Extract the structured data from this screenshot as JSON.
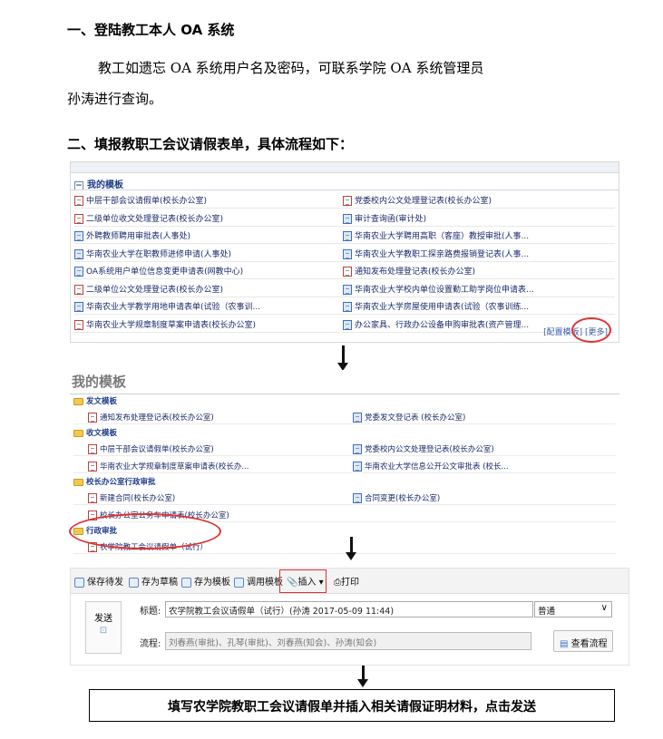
{
  "heading1": "一、登陆教工本人 OA 系统",
  "paragraph_line1": "教工如遗忘 OA 系统用户名及密码，可联系学院 OA 系统管理员",
  "paragraph_line2": "孙涛进行查询。",
  "heading2": "二、填报教职工会议请假表单，具体流程如下：",
  "panel1": {
    "title": "我的模板",
    "rows": [
      {
        "left": "中层干部会议请假单(校长办公室)",
        "right": "党委校内公文处理登记表(校长办公室)"
      },
      {
        "left": "二级单位收文处理登记表(校长办公室)",
        "right": "审计查询函(审计处)"
      },
      {
        "left": "外聘教师聘用审批表(人事处)",
        "right": "华南农业大学聘用高职（客座）教授审批(人事..."
      },
      {
        "left": "华南农业大学在职教师进修申请(人事处)",
        "right": "华南农业大学教职工探亲路费报销登记表(人事..."
      },
      {
        "left": "OA系统用户单位信息变更申请表(网教中心)",
        "right": "通知发布处理登记表(校长办公室)"
      },
      {
        "left": "二级单位公文处理登记表(校长办公室)",
        "right": "华南农业大学校内单位设置勤工助学岗位申请表..."
      },
      {
        "left": "华南农业大学教学用地申请表单(试验（农事训...",
        "right": "华南农业大学房屋使用申请表(试验（农事训练..."
      },
      {
        "left": "华南农业大学规章制度草案申请表(校长办公室)",
        "right": "办公家具、行政办公设备申购审批表(资产管理..."
      }
    ],
    "footer_config": "[配置模板]",
    "footer_more": "[更多]"
  },
  "panel2": {
    "title": "我的模板",
    "groups": [
      {
        "name": "发文模板",
        "rows": [
          {
            "left": "通知发布处理登记表(校长办公室)",
            "right": "党委发文登记表 (校长办公室)"
          }
        ]
      },
      {
        "name": "收文模板",
        "rows": [
          {
            "left": "中层干部会议请假单(校长办公室)",
            "right": "党委校内公文处理登记表(校长办公室)"
          },
          {
            "left": "华南农业大学规章制度草案申请表(校长办...",
            "right": "华南农业大学信息公开公文审批表 (校长..."
          }
        ]
      },
      {
        "name": "校长办公室行政审批",
        "rows": [
          {
            "left": "新建合同(校长办公室)",
            "right": "合同变更(校长办公室)"
          },
          {
            "left": "校长办公室公务车申请表(校长办公室)",
            "right": ""
          }
        ]
      },
      {
        "name": "行政审批",
        "rows": [
          {
            "left": "农学院教工会议请假单（试行）",
            "right": ""
          }
        ]
      }
    ]
  },
  "panel3": {
    "toolbar": {
      "save_send": "保存待发",
      "save_draft": "存为草稿",
      "save_template": "存为模板",
      "use_template": "调用模板",
      "insert": "插入",
      "print": "打印"
    },
    "send_label": "发送",
    "title_label": "标题:",
    "title_value": "农学院教工会议请假单（试行）(孙涛 2017-05-09 11:44)",
    "priority_value": "普通",
    "flow_label": "流程:",
    "flow_value": "刘春燕(审批)、孔琴(审批)、刘春燕(知会)、孙涛(知会)",
    "view_flow": "查看流程"
  },
  "final_instruction": "填写农学院教职工会议请假单并插入相关请假证明材料，点击发送",
  "colors": {
    "highlight": "#e03030",
    "link": "#1b2a6b"
  }
}
